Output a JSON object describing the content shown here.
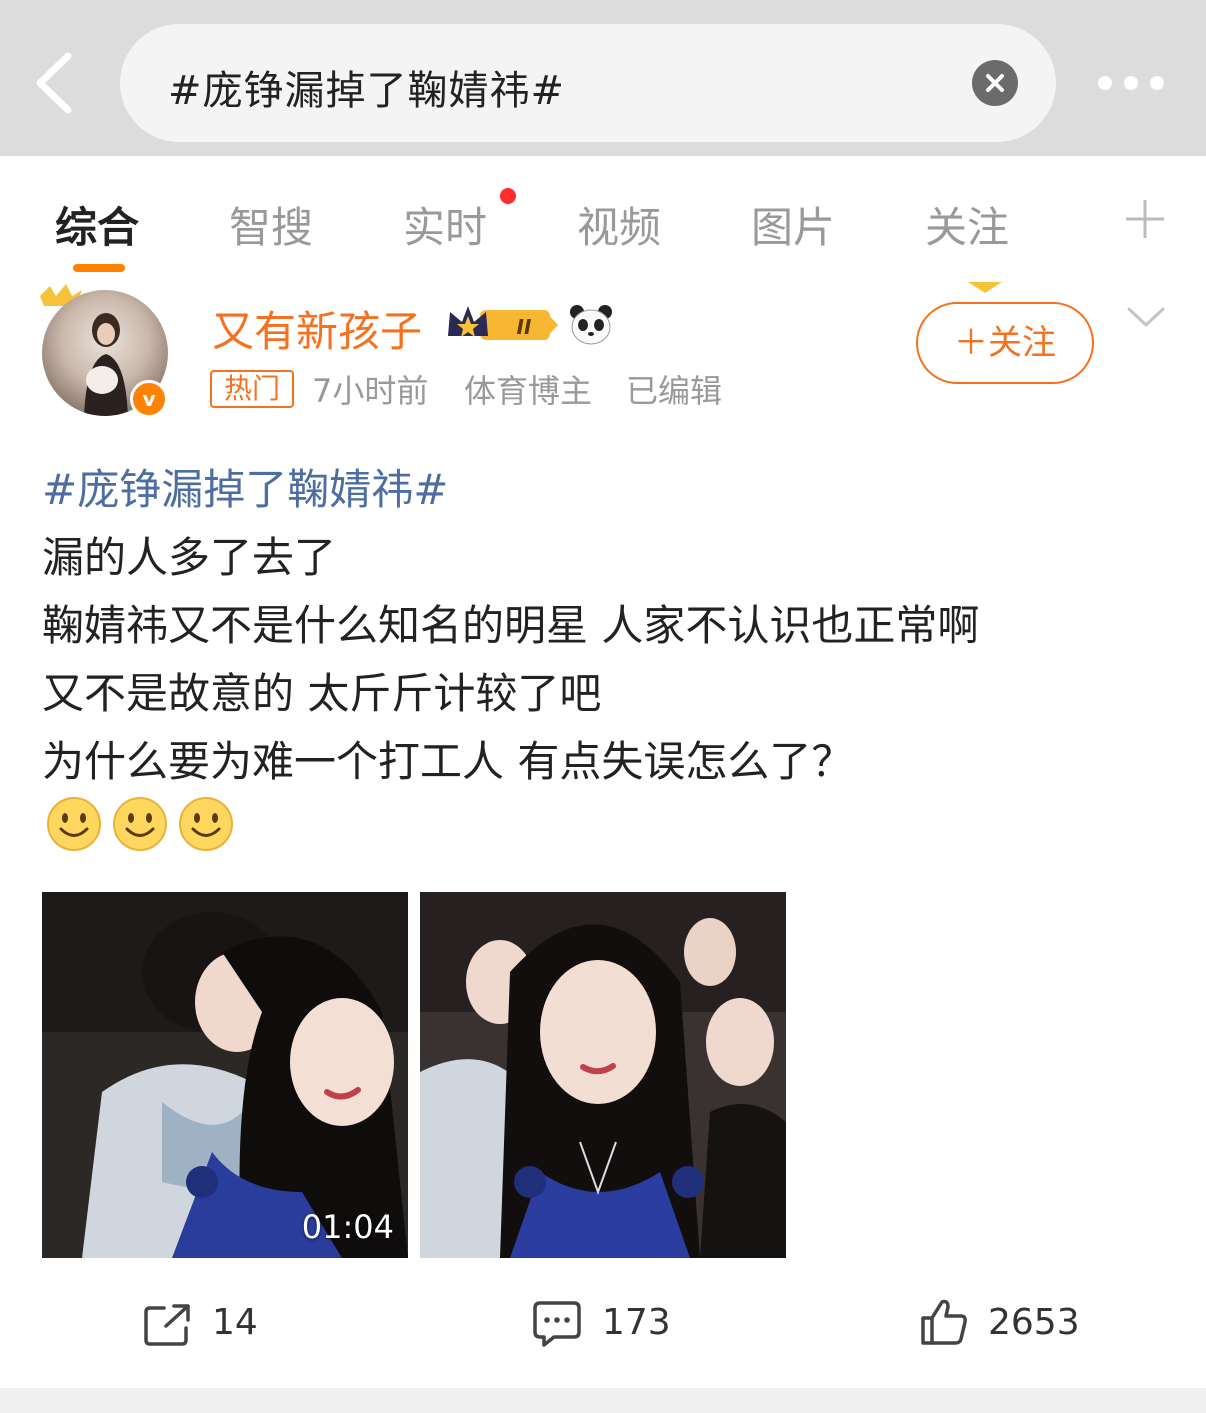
{
  "search": {
    "query": "#庞铮漏掉了鞠婧祎#"
  },
  "tabs": [
    {
      "label": "综合",
      "active": true
    },
    {
      "label": "智搜"
    },
    {
      "label": "实时",
      "has_dot": true
    },
    {
      "label": "视频"
    },
    {
      "label": "图片"
    },
    {
      "label": "关注"
    }
  ],
  "post": {
    "author": {
      "name": "又有新孩子",
      "level_badge": "II",
      "verified_mark": "v"
    },
    "hot_tag": "热门",
    "time": "7小时前",
    "category": "体育博主",
    "edited": "已编辑",
    "follow_label": "＋关注",
    "hashtag": "#庞铮漏掉了鞠婧祎#",
    "lines": [
      "漏的人多了去了",
      "鞠婧祎又不是什么知名的明星 人家不认识也正常啊",
      "又不是故意的  太斤斤计较了吧",
      "为什么要为难一个打工人  有点失误怎么了？"
    ],
    "emojis": [
      "smile-emoji",
      "smile-emoji",
      "smile-emoji"
    ],
    "media": [
      {
        "type": "video",
        "duration": "01:04"
      },
      {
        "type": "image"
      }
    ],
    "actions": {
      "repost_count": "14",
      "comment_count": "173",
      "like_count": "2653"
    }
  },
  "colors": {
    "accent": "#ff8200",
    "username": "#f5711f",
    "hashtag": "#4e6ea1",
    "muted": "#999999"
  }
}
